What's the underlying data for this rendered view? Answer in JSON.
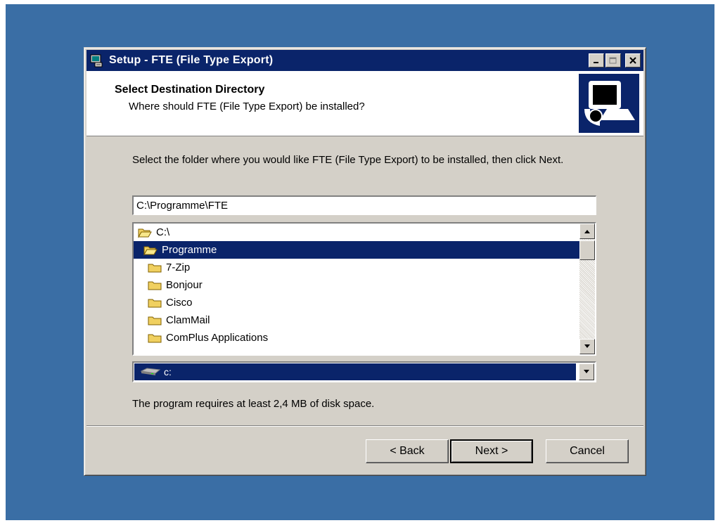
{
  "window": {
    "title": "Setup - FTE (File Type Export)",
    "minimize_label": "_",
    "maximize_label": "□",
    "close_label": "✕"
  },
  "header": {
    "title": "Select Destination Directory",
    "subtitle": "Where should FTE (File Type Export) be installed?"
  },
  "main": {
    "instruction": "Select the folder where you would like FTE (File Type Export) to be installed, then click Next.",
    "path_value": "C:\\Programme\\FTE",
    "folders": [
      {
        "label": "C:\\",
        "level": 0,
        "open": true,
        "selected": false
      },
      {
        "label": "Programme",
        "level": 1,
        "open": true,
        "selected": true
      },
      {
        "label": "7-Zip",
        "level": 2,
        "open": false,
        "selected": false
      },
      {
        "label": "Bonjour",
        "level": 2,
        "open": false,
        "selected": false
      },
      {
        "label": "Cisco",
        "level": 2,
        "open": false,
        "selected": false
      },
      {
        "label": "ClamMail",
        "level": 2,
        "open": false,
        "selected": false
      },
      {
        "label": "ComPlus Applications",
        "level": 2,
        "open": false,
        "selected": false
      }
    ],
    "drive_selected": "c:",
    "space_text": "The program requires at least 2,4 MB of disk space."
  },
  "buttons": {
    "back": "< Back",
    "next": "Next >",
    "cancel": "Cancel"
  },
  "colors": {
    "desktop": "#3a6ea5",
    "titlebar": "#0a246a",
    "selection": "#0a246a",
    "face": "#d4d0c8"
  }
}
